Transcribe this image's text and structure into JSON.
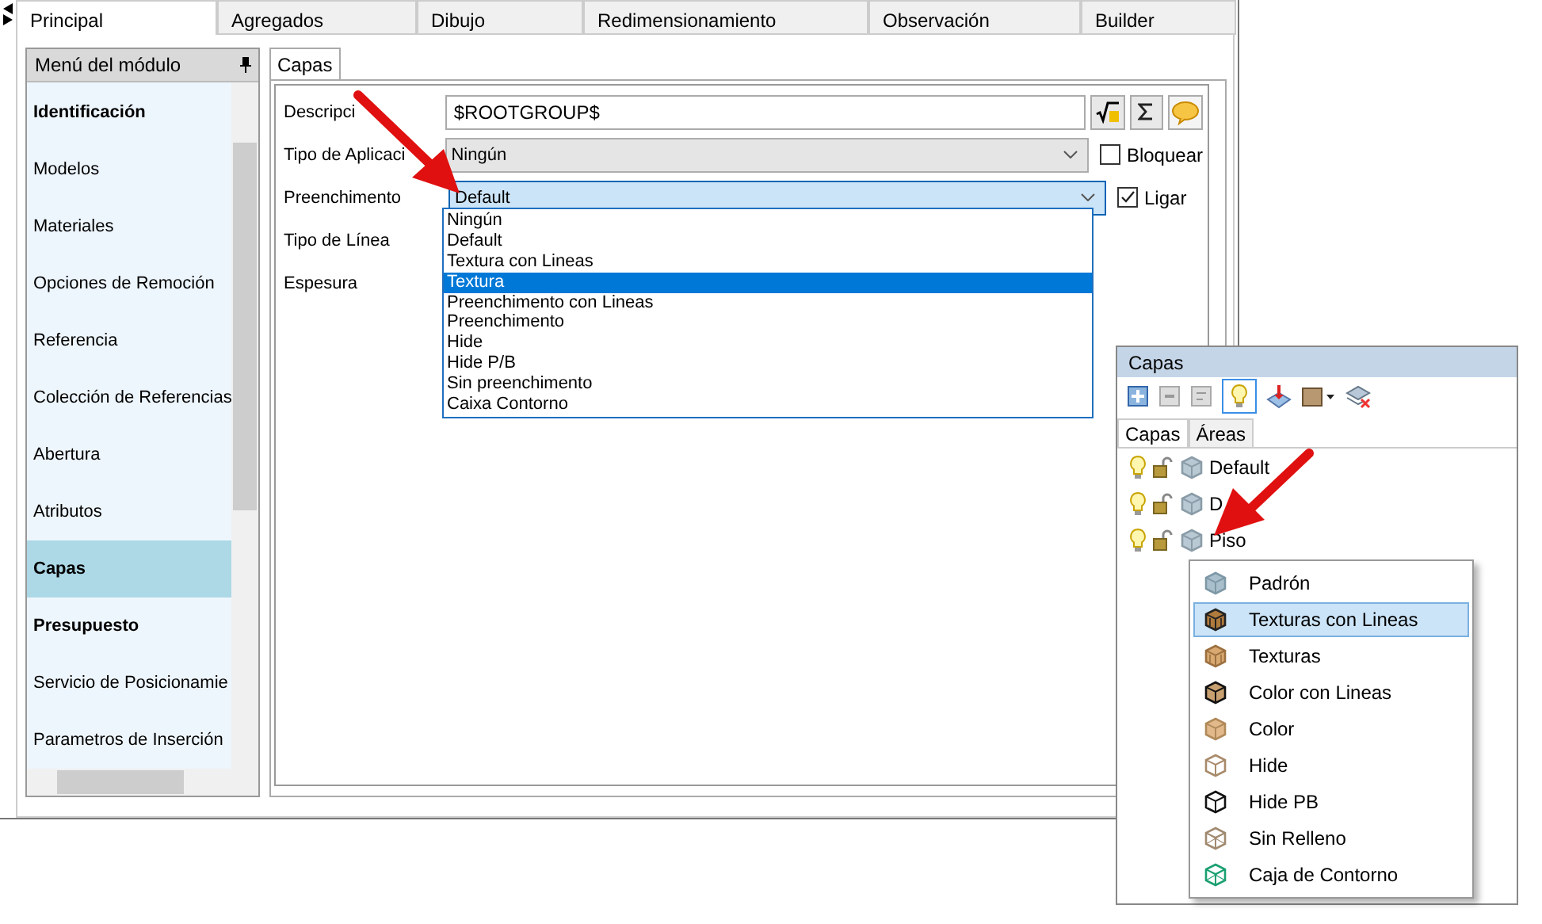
{
  "window_tabs": [
    {
      "label": "Principal",
      "selected": true
    },
    {
      "label": "Agregados",
      "selected": false
    },
    {
      "label": "Dibujo",
      "selected": false
    },
    {
      "label": "Redimensionamiento",
      "selected": false
    },
    {
      "label": "Observación",
      "selected": false
    },
    {
      "label": "Builder",
      "selected": false
    }
  ],
  "module_menu": {
    "title": "Menú del módulo",
    "items": [
      {
        "label": "Identificación",
        "bold": true,
        "selected": false
      },
      {
        "label": "Modelos",
        "bold": false,
        "selected": false
      },
      {
        "label": "Materiales",
        "bold": false,
        "selected": false
      },
      {
        "label": "Opciones de Remoción",
        "bold": false,
        "selected": false
      },
      {
        "label": "Referencia",
        "bold": false,
        "selected": false
      },
      {
        "label": "Colección de Referencias",
        "bold": false,
        "selected": false
      },
      {
        "label": "Abertura",
        "bold": false,
        "selected": false
      },
      {
        "label": "Atributos",
        "bold": false,
        "selected": false
      },
      {
        "label": "Capas",
        "bold": true,
        "selected": true
      },
      {
        "label": "Presupuesto",
        "bold": true,
        "selected": false
      },
      {
        "label": "Servicio de Posicionamie",
        "bold": false,
        "selected": false
      },
      {
        "label": "Parametros de Inserción",
        "bold": false,
        "selected": false
      }
    ]
  },
  "inner_tabs": [
    {
      "label": "Capas",
      "selected": true
    }
  ],
  "form": {
    "fields": [
      {
        "label": "Descripci",
        "kind": "text",
        "value": "$ROOTGROUP$"
      },
      {
        "label": "Tipo de Aplicaci",
        "kind": "select",
        "value": "Ningún",
        "disabled": true,
        "focused": false
      },
      {
        "label": "Preenchimento",
        "kind": "select",
        "value": "Default",
        "disabled": false,
        "focused": true
      },
      {
        "label": "Tipo de Línea",
        "kind": "covered"
      },
      {
        "label": "Espesura",
        "kind": "covered"
      }
    ],
    "checkboxes": [
      {
        "label": "Bloquear",
        "checked": false
      },
      {
        "label": "Ligar",
        "checked": true
      }
    ]
  },
  "dropdown": {
    "options": [
      {
        "label": "Ningún",
        "selected": false
      },
      {
        "label": "Default",
        "selected": false
      },
      {
        "label": "Textura con Lineas",
        "selected": false
      },
      {
        "label": "Textura",
        "selected": true
      },
      {
        "label": "Preenchimento con Lineas",
        "selected": false
      },
      {
        "label": "Preenchimento",
        "selected": false
      },
      {
        "label": "Hide",
        "selected": false
      },
      {
        "label": "Hide P/B",
        "selected": false
      },
      {
        "label": "Sin preenchimento",
        "selected": false
      },
      {
        "label": "Caixa Contorno",
        "selected": false
      }
    ]
  },
  "layers_panel": {
    "title": "Capas",
    "tabs": [
      {
        "label": "Capas",
        "selected": true
      },
      {
        "label": "Áreas",
        "selected": false
      }
    ],
    "layers": [
      {
        "name": "Default"
      },
      {
        "name": "D"
      },
      {
        "name": "Piso"
      }
    ],
    "context_menu": [
      {
        "label": "Padrón",
        "kind": "plain",
        "selected": false
      },
      {
        "label": "Texturas con Lineas",
        "kind": "texture_lines",
        "selected": true
      },
      {
        "label": "Texturas",
        "kind": "texture",
        "selected": false
      },
      {
        "label": "Color con Lineas",
        "kind": "color_lines",
        "selected": false
      },
      {
        "label": "Color",
        "kind": "color",
        "selected": false
      },
      {
        "label": "Hide",
        "kind": "hide",
        "selected": false
      },
      {
        "label": "Hide PB",
        "kind": "hide_bw",
        "selected": false
      },
      {
        "label": "Sin Relleno",
        "kind": "no_fill",
        "selected": false
      },
      {
        "label": "Caja de Contorno",
        "kind": "bounding_box",
        "selected": false
      }
    ]
  }
}
